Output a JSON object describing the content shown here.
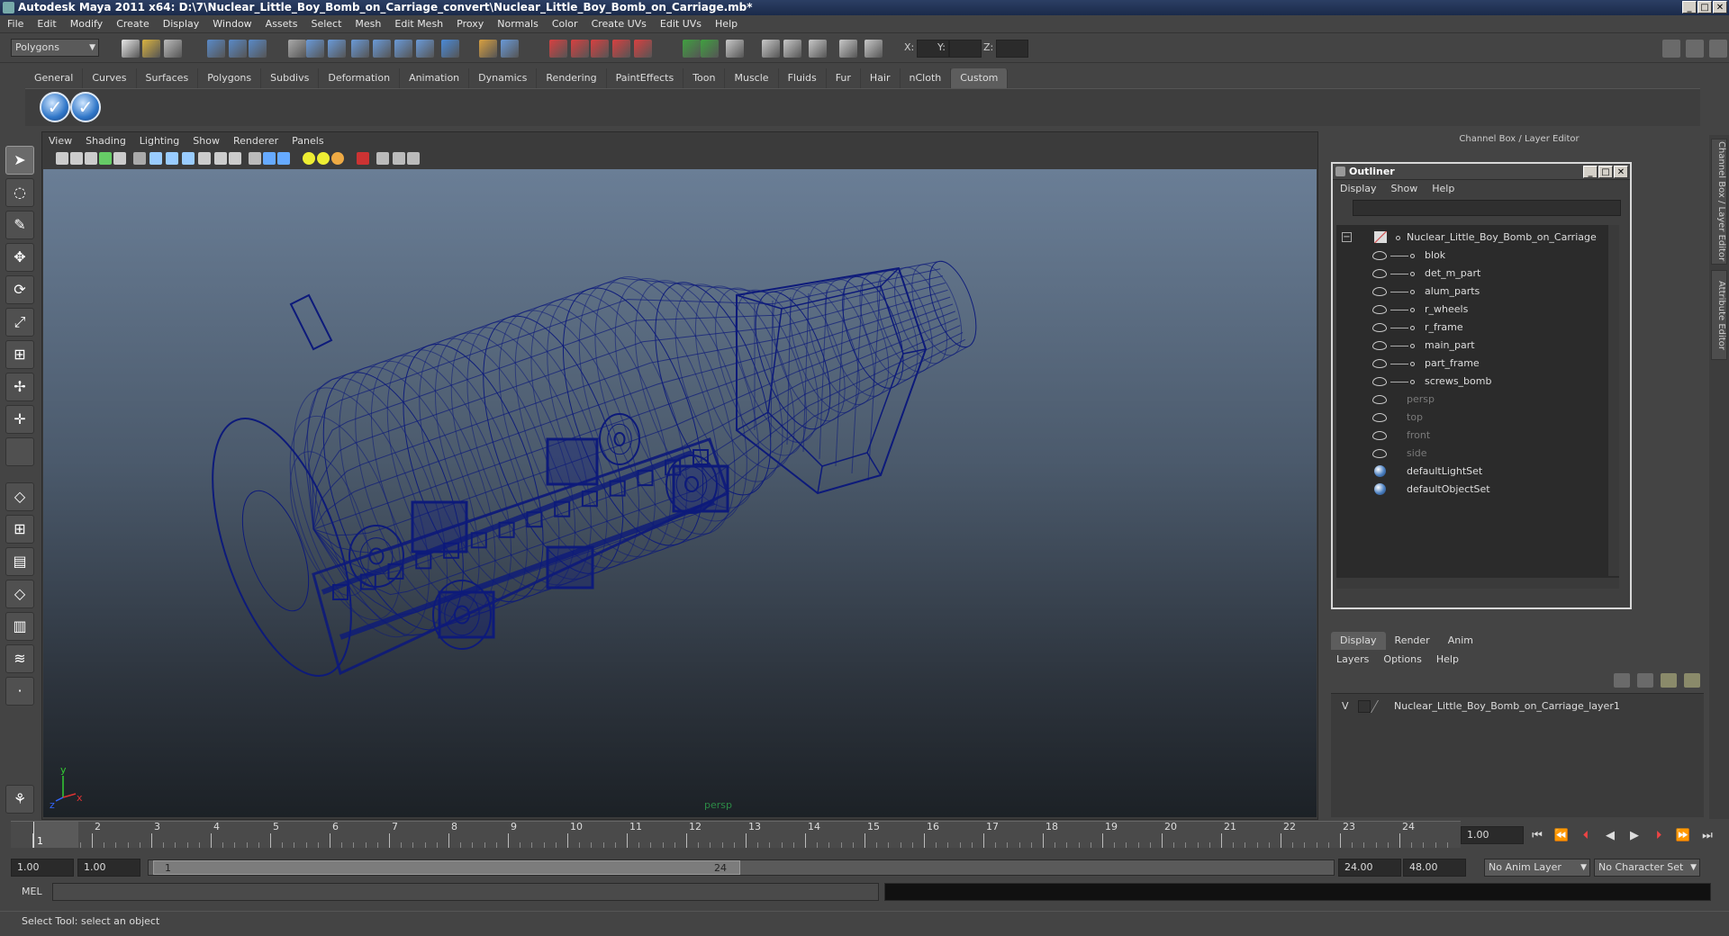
{
  "window": {
    "title": "Autodesk Maya 2011 x64: D:\\7\\Nuclear_Little_Boy_Bomb_on_Carriage_convert\\Nuclear_Little_Boy_Bomb_on_Carriage.mb*",
    "minimize": "_",
    "maximize": "□",
    "close": "✕"
  },
  "menubar": [
    "File",
    "Edit",
    "Modify",
    "Create",
    "Display",
    "Window",
    "Assets",
    "Select",
    "Mesh",
    "Edit Mesh",
    "Proxy",
    "Normals",
    "Color",
    "Create UVs",
    "Edit UVs",
    "Help"
  ],
  "statusline": {
    "mode": "Polygons",
    "x_label": "X:",
    "y_label": "Y:",
    "z_label": "Z:"
  },
  "shelf": {
    "tabs": [
      "General",
      "Curves",
      "Surfaces",
      "Polygons",
      "Subdivs",
      "Deformation",
      "Animation",
      "Dynamics",
      "Rendering",
      "PaintEffects",
      "Toon",
      "Muscle",
      "Fluids",
      "Fur",
      "Hair",
      "nCloth",
      "Custom"
    ],
    "active_tab": "Custom",
    "check_glyph": "✓"
  },
  "viewport": {
    "menu": [
      "View",
      "Shading",
      "Lighting",
      "Show",
      "Renderer",
      "Panels"
    ],
    "camera": "persp",
    "axis_y": "y",
    "axis_x": "x",
    "axis_z": "z",
    "wire_color": "#0d1a7a"
  },
  "channel_box": {
    "header": "Channel Box / Layer Editor"
  },
  "side_tabs": [
    "Channel Box / Layer Editor",
    "Attribute Editor"
  ],
  "outliner": {
    "title": "Outliner",
    "menu": [
      "Display",
      "Show",
      "Help"
    ],
    "root": "Nuclear_Little_Boy_Bomb_on_Carriage",
    "children": [
      "blok",
      "det_m_part",
      "alum_parts",
      "r_wheels",
      "r_frame",
      "main_part",
      "part_frame",
      "screws_bomb"
    ],
    "cameras": [
      "persp",
      "top",
      "front",
      "side"
    ],
    "sets": [
      "defaultLightSet",
      "defaultObjectSet"
    ],
    "collapse": "−"
  },
  "layer_editor": {
    "tabs": [
      "Display",
      "Render",
      "Anim"
    ],
    "active_tab": "Display",
    "menu": [
      "Layers",
      "Options",
      "Help"
    ],
    "visibility": "V",
    "layer_name": "Nuclear_Little_Boy_Bomb_on_Carriage_layer1"
  },
  "timeline": {
    "ticks": [
      "1",
      "2",
      "3",
      "4",
      "5",
      "6",
      "7",
      "8",
      "9",
      "10",
      "11",
      "12",
      "13",
      "14",
      "15",
      "16",
      "17",
      "18",
      "19",
      "20",
      "21",
      "22",
      "23",
      "24"
    ],
    "current_frame": "1",
    "current_time": "1.00"
  },
  "range": {
    "start_time": "1.00",
    "playback_start": "1.00",
    "slider_start": "1",
    "slider_end": "24",
    "playback_end": "24.00",
    "end_time": "48.00",
    "anim_layer": "No Anim Layer",
    "character_set": "No Character Set"
  },
  "cmdline": {
    "label": "MEL"
  },
  "helpline": {
    "text": "Select Tool: select an object"
  }
}
